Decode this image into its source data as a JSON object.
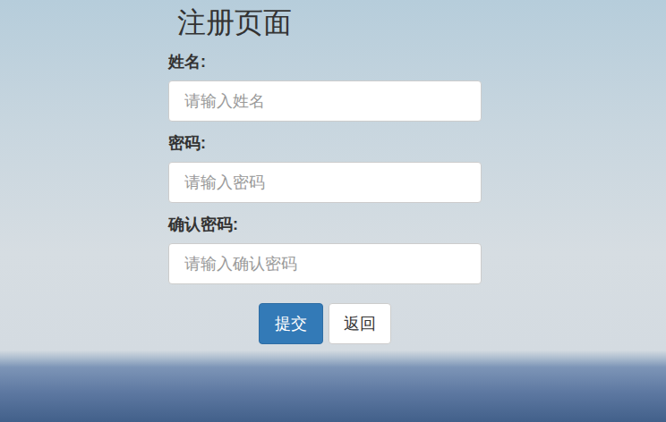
{
  "page": {
    "title": "注册页面"
  },
  "fields": [
    {
      "label": "姓名:",
      "placeholder": "请输入姓名",
      "type": "text"
    },
    {
      "label": "密码:",
      "placeholder": "请输入密码",
      "type": "password"
    },
    {
      "label": "确认密码:",
      "placeholder": "请输入确认密码",
      "type": "password"
    }
  ],
  "buttons": [
    {
      "label": "提交",
      "kind": "primary"
    },
    {
      "label": "返回",
      "kind": "default"
    }
  ]
}
